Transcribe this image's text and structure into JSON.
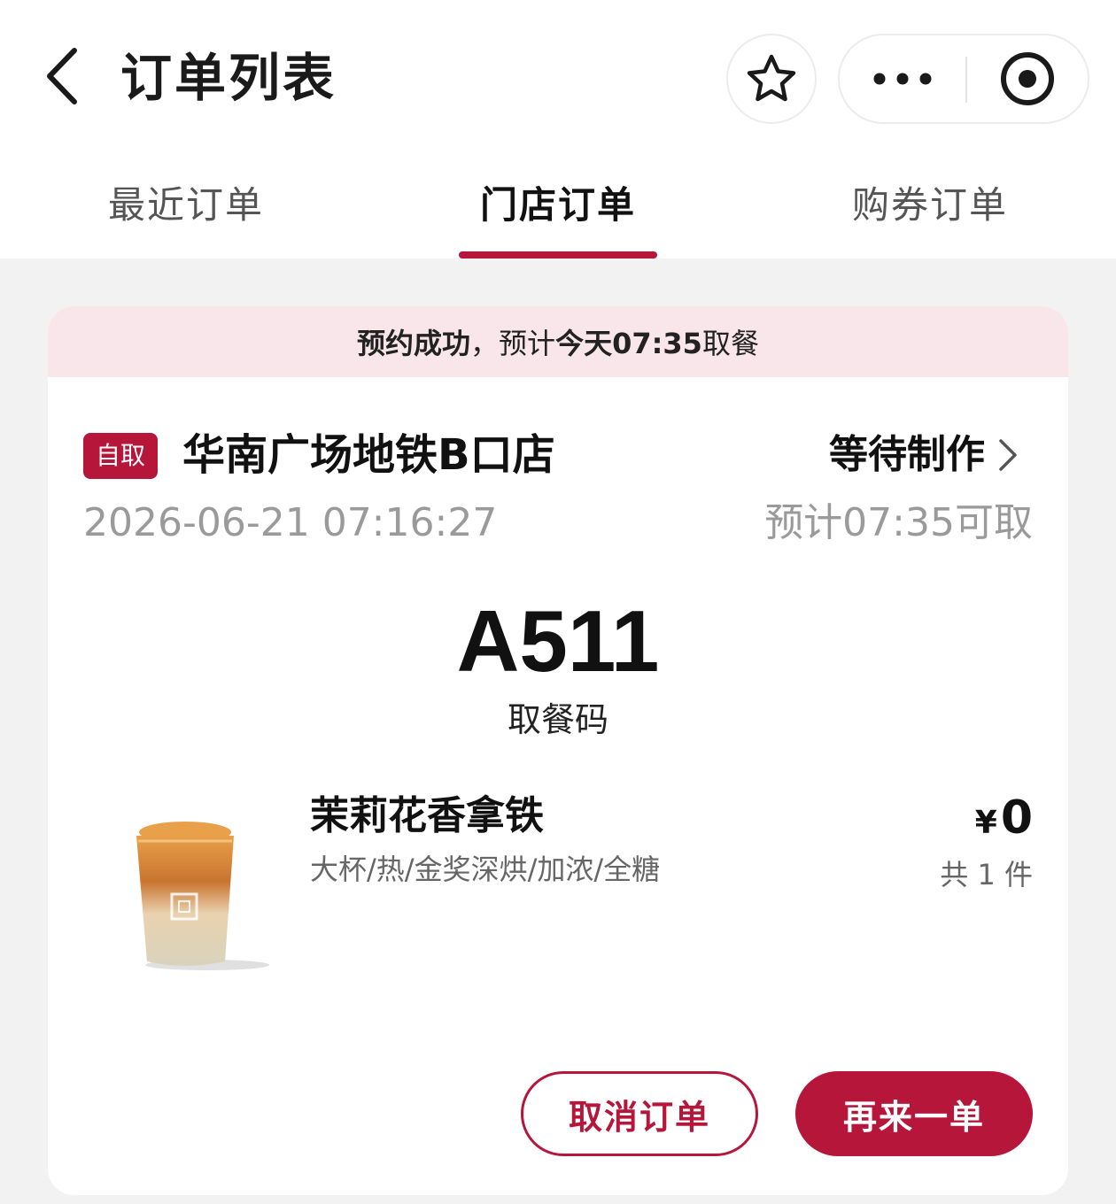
{
  "header": {
    "title": "订单列表",
    "back_icon": "chevron-left-icon",
    "favorite_icon": "star-outline-icon",
    "more_icon": "more-dots-icon",
    "close_icon": "target-circle-icon"
  },
  "tabs": [
    {
      "label": "最近订单",
      "active": false
    },
    {
      "label": "门店订单",
      "active": true
    },
    {
      "label": "购券订单",
      "active": false
    }
  ],
  "order": {
    "banner": {
      "prefix": "预约成功",
      "separator": "，预计",
      "time": "今天07:35",
      "suffix": "取餐"
    },
    "type_tag": "自取",
    "store_name": "华南广场地铁B口店",
    "status": "等待制作",
    "order_time": "2026-06-21 07:16:27",
    "eta": "预计07:35可取",
    "pickup_code": "A511",
    "pickup_code_label": "取餐码",
    "item": {
      "name": "茉莉花香拿铁",
      "spec": "大杯/热/金奖深烘/加浓/全糖",
      "currency": "¥",
      "price": "0",
      "quantity": "共 1 件",
      "image_icon": "latte-cup-image"
    },
    "actions": {
      "cancel_label": "取消订单",
      "reorder_label": "再来一单"
    }
  },
  "colors": {
    "accent": "#b5163a",
    "banner_bg": "#f8e6ea",
    "page_bg": "#f2f2f2",
    "muted_text": "#9a9a9a"
  }
}
